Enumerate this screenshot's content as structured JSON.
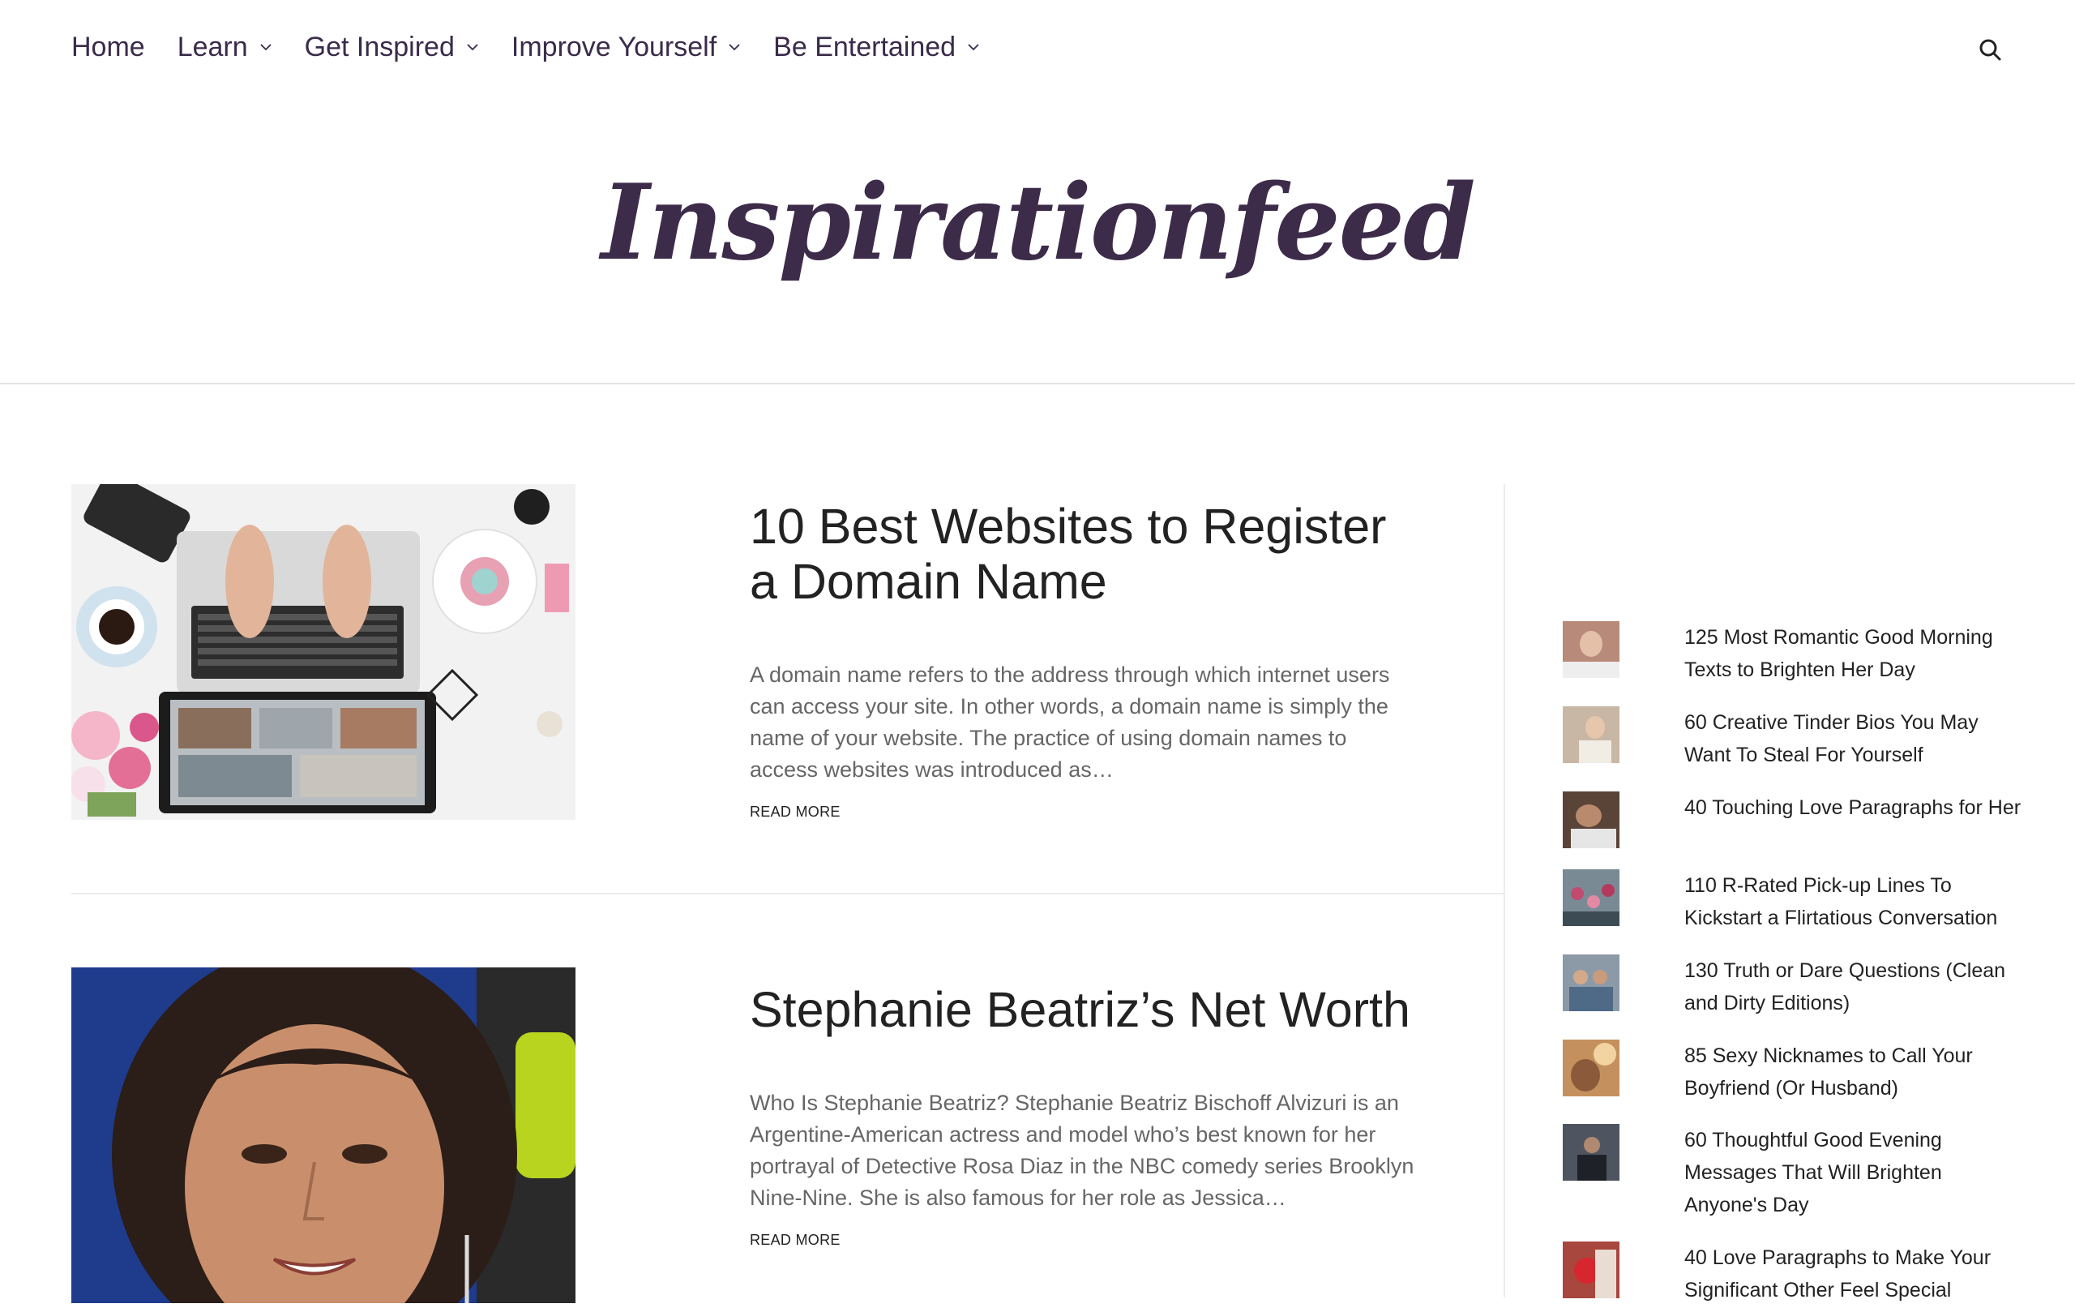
{
  "nav": {
    "items": [
      {
        "label": "Home",
        "has_dropdown": false
      },
      {
        "label": "Learn",
        "has_dropdown": true
      },
      {
        "label": "Get Inspired",
        "has_dropdown": true
      },
      {
        "label": "Improve Yourself",
        "has_dropdown": true
      },
      {
        "label": "Be Entertained",
        "has_dropdown": true
      }
    ],
    "search_icon": "search-icon"
  },
  "logo": {
    "text": "Inspirationfeed",
    "color": "#3d2b4a"
  },
  "posts": [
    {
      "title": "10 Best Websites to Register a Domain Name",
      "excerpt": "A domain name refers to the address through which internet users can access your site. In other words, a domain name is simply the name of your website.  The practice of using domain names to access websites was introduced as…",
      "read_more": "READ MORE",
      "image": "laptop-desk-photo"
    },
    {
      "title": "Stephanie Beatriz’s Net Worth",
      "excerpt": "Who Is Stephanie Beatriz? Stephanie Beatriz Bischoff Alvizuri is an Argentine-American actress and model who’s best known for her portrayal of Detective Rosa Diaz in the NBC comedy series Brooklyn Nine-Nine. She is also famous for her role as Jessica…",
      "read_more": "READ MORE",
      "image": "portrait-photo"
    }
  ],
  "sidebar": {
    "items": [
      {
        "title": "125 Most Romantic Good Morning Texts to Brighten Her Day",
        "thumb_color": "#b88a7a"
      },
      {
        "title": "60 Creative Tinder Bios You May Want To Steal For Yourself",
        "thumb_color": "#c9b7a5"
      },
      {
        "title": "40 Touching Love Paragraphs for Her",
        "thumb_color": "#5a4438"
      },
      {
        "title": "110 R-Rated Pick-up Lines To Kickstart a Flirtatious Conversation",
        "thumb_color": "#7a8a94"
      },
      {
        "title": "130 Truth or Dare Questions (Clean and Dirty Editions)",
        "thumb_color": "#8c9aa8"
      },
      {
        "title": "85 Sexy Nicknames to Call Your Boyfriend (Or Husband)",
        "thumb_color": "#c4915e"
      },
      {
        "title": "60 Thoughtful Good Evening Messages That Will Brighten Anyone's Day",
        "thumb_color": "#4e5560"
      },
      {
        "title": "40 Love Paragraphs to Make Your Significant Other Feel Special",
        "thumb_color": "#a8473e"
      }
    ]
  }
}
